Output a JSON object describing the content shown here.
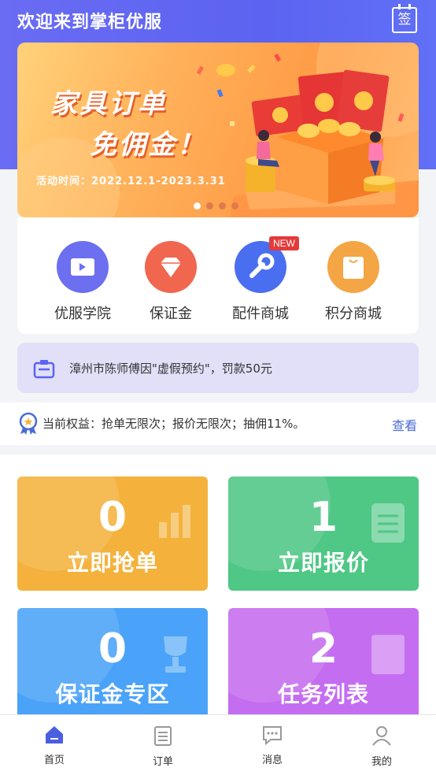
{
  "header": {
    "title": "欢迎来到掌柜优服",
    "sign_label": "签"
  },
  "banner": {
    "title_line1": "家具订单",
    "title_line2": "免佣金！",
    "date": "活动时间：2022.12.1-2023.3.31",
    "dots": 4,
    "active_dot": 1
  },
  "quick_menu": {
    "items": [
      {
        "label": "优服学院",
        "icon": "video-book-icon",
        "color": "#6c6ff0"
      },
      {
        "label": "保证金",
        "icon": "diamond-icon",
        "color": "#f0664f"
      },
      {
        "label": "配件商城",
        "icon": "wrench-icon",
        "color": "#4a6ef0"
      },
      {
        "label": "积分商城",
        "icon": "shopping-bag-icon",
        "color": "#f4a544"
      }
    ],
    "badge": "NEW"
  },
  "notice": {
    "text": "漳州市陈师傅因\"虚假预约\"，罚款50元"
  },
  "rights": {
    "text": "当前权益：抢单无限次；报价无限次；抽佣11%。",
    "link": "查看"
  },
  "cards": [
    {
      "value": "0",
      "label": "立即抢单",
      "color": "#f4b23d",
      "icon": "chart-icon"
    },
    {
      "value": "1",
      "label": "立即报价",
      "color": "#4fc785",
      "icon": "document-icon"
    },
    {
      "value": "0",
      "label": "保证金专区",
      "color": "#4aa3f8",
      "icon": "trophy-icon"
    },
    {
      "value": "2",
      "label": "任务列表",
      "color": "#c56df0",
      "icon": "notebook-icon"
    }
  ],
  "tabbar": {
    "items": [
      {
        "label": "首页",
        "icon": "home-icon",
        "active": true
      },
      {
        "label": "订单",
        "icon": "clipboard-icon",
        "active": false
      },
      {
        "label": "消息",
        "icon": "message-icon",
        "active": false
      },
      {
        "label": "我的",
        "icon": "user-icon",
        "active": false
      }
    ],
    "active_color": "#4a5fe0"
  }
}
